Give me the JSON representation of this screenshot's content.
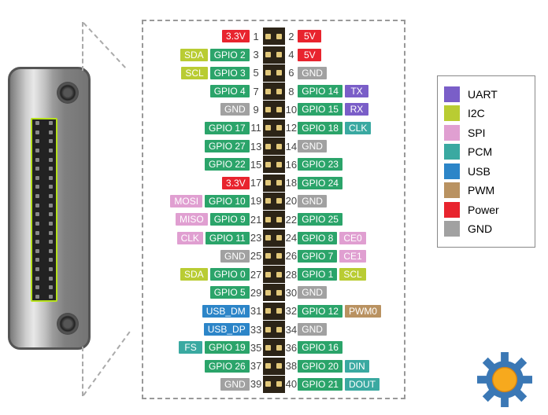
{
  "legend": [
    {
      "name": "UART",
      "class": "c-uart"
    },
    {
      "name": "I2C",
      "class": "c-i2c"
    },
    {
      "name": "SPI",
      "class": "c-spi"
    },
    {
      "name": "PCM",
      "class": "c-pcm"
    },
    {
      "name": "USB",
      "class": "c-usb"
    },
    {
      "name": "PWM",
      "class": "c-pwm"
    },
    {
      "name": "Power",
      "class": "c-power"
    },
    {
      "name": "GND",
      "class": "c-gnd"
    }
  ],
  "rows": [
    {
      "n1": 1,
      "n2": 2,
      "l": [
        {
          "t": "3.3V",
          "c": "c-power"
        }
      ],
      "r": [
        {
          "t": "5V",
          "c": "c-power"
        }
      ]
    },
    {
      "n1": 3,
      "n2": 4,
      "l": [
        {
          "t": "SDA",
          "c": "c-i2c"
        },
        {
          "t": "GPIO 2",
          "c": "c-gpio"
        }
      ],
      "r": [
        {
          "t": "5V",
          "c": "c-power"
        }
      ]
    },
    {
      "n1": 5,
      "n2": 6,
      "l": [
        {
          "t": "SCL",
          "c": "c-i2c"
        },
        {
          "t": "GPIO 3",
          "c": "c-gpio"
        }
      ],
      "r": [
        {
          "t": "GND",
          "c": "c-gnd"
        }
      ]
    },
    {
      "n1": 7,
      "n2": 8,
      "l": [
        {
          "t": "GPIO 4",
          "c": "c-gpio"
        }
      ],
      "r": [
        {
          "t": "GPIO 14",
          "c": "c-gpio"
        },
        {
          "t": "TX",
          "c": "c-uart"
        }
      ]
    },
    {
      "n1": 9,
      "n2": 10,
      "l": [
        {
          "t": "GND",
          "c": "c-gnd"
        }
      ],
      "r": [
        {
          "t": "GPIO 15",
          "c": "c-gpio"
        },
        {
          "t": "RX",
          "c": "c-uart"
        }
      ]
    },
    {
      "n1": 11,
      "n2": 12,
      "l": [
        {
          "t": "GPIO 17",
          "c": "c-gpio"
        }
      ],
      "r": [
        {
          "t": "GPIO 18",
          "c": "c-gpio"
        },
        {
          "t": "CLK",
          "c": "c-pcm"
        }
      ]
    },
    {
      "n1": 13,
      "n2": 14,
      "l": [
        {
          "t": "GPIO 27",
          "c": "c-gpio"
        }
      ],
      "r": [
        {
          "t": "GND",
          "c": "c-gnd"
        }
      ]
    },
    {
      "n1": 15,
      "n2": 16,
      "l": [
        {
          "t": "GPIO 22",
          "c": "c-gpio"
        }
      ],
      "r": [
        {
          "t": "GPIO 23",
          "c": "c-gpio"
        }
      ]
    },
    {
      "n1": 17,
      "n2": 18,
      "l": [
        {
          "t": "3.3V",
          "c": "c-power"
        }
      ],
      "r": [
        {
          "t": "GPIO 24",
          "c": "c-gpio"
        }
      ]
    },
    {
      "n1": 19,
      "n2": 20,
      "l": [
        {
          "t": "MOSI",
          "c": "c-spi"
        },
        {
          "t": "GPIO 10",
          "c": "c-gpio"
        }
      ],
      "r": [
        {
          "t": "GND",
          "c": "c-gnd"
        }
      ]
    },
    {
      "n1": 21,
      "n2": 22,
      "l": [
        {
          "t": "MISO",
          "c": "c-spi"
        },
        {
          "t": "GPIO 9",
          "c": "c-gpio"
        }
      ],
      "r": [
        {
          "t": "GPIO 25",
          "c": "c-gpio"
        }
      ]
    },
    {
      "n1": 23,
      "n2": 24,
      "l": [
        {
          "t": "CLK",
          "c": "c-spi"
        },
        {
          "t": "GPIO 11",
          "c": "c-gpio"
        }
      ],
      "r": [
        {
          "t": "GPIO 8",
          "c": "c-gpio"
        },
        {
          "t": "CE0",
          "c": "c-spi"
        }
      ]
    },
    {
      "n1": 25,
      "n2": 26,
      "l": [
        {
          "t": "GND",
          "c": "c-gnd"
        }
      ],
      "r": [
        {
          "t": "GPIO 7",
          "c": "c-gpio"
        },
        {
          "t": "CE1",
          "c": "c-spi"
        }
      ]
    },
    {
      "n1": 27,
      "n2": 28,
      "l": [
        {
          "t": "SDA",
          "c": "c-i2c"
        },
        {
          "t": "GPIO 0",
          "c": "c-gpio"
        }
      ],
      "r": [
        {
          "t": "GPIO 1",
          "c": "c-gpio"
        },
        {
          "t": "SCL",
          "c": "c-i2c"
        }
      ]
    },
    {
      "n1": 29,
      "n2": 30,
      "l": [
        {
          "t": "GPIO 5",
          "c": "c-gpio"
        }
      ],
      "r": [
        {
          "t": "GND",
          "c": "c-gnd"
        }
      ]
    },
    {
      "n1": 31,
      "n2": 32,
      "l": [
        {
          "t": "USB_DM",
          "c": "c-usb"
        }
      ],
      "r": [
        {
          "t": "GPIO 12",
          "c": "c-gpio"
        },
        {
          "t": "PWM0",
          "c": "c-pwm"
        }
      ]
    },
    {
      "n1": 33,
      "n2": 34,
      "l": [
        {
          "t": "USB_DP",
          "c": "c-usb"
        }
      ],
      "r": [
        {
          "t": "GND",
          "c": "c-gnd"
        }
      ]
    },
    {
      "n1": 35,
      "n2": 36,
      "l": [
        {
          "t": "FS",
          "c": "c-pcm"
        },
        {
          "t": "GPIO 19",
          "c": "c-gpio"
        }
      ],
      "r": [
        {
          "t": "GPIO 16",
          "c": "c-gpio"
        }
      ]
    },
    {
      "n1": 37,
      "n2": 38,
      "l": [
        {
          "t": "GPIO 26",
          "c": "c-gpio"
        }
      ],
      "r": [
        {
          "t": "GPIO 20",
          "c": "c-gpio"
        },
        {
          "t": "DIN",
          "c": "c-pcm"
        }
      ]
    },
    {
      "n1": 39,
      "n2": 40,
      "l": [
        {
          "t": "GND",
          "c": "c-gnd"
        }
      ],
      "r": [
        {
          "t": "GPIO 21",
          "c": "c-gpio"
        },
        {
          "t": "DOUT",
          "c": "c-pcm"
        }
      ]
    }
  ]
}
